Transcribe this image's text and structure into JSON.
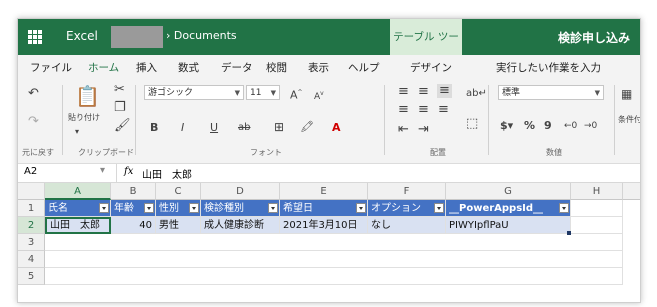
{
  "titlebar": {
    "app_name": "Excel",
    "breadcrumb": "Documents",
    "breadcrumb_sep": "›",
    "table_tools": "テーブル ツール",
    "doc_title": "検診申し込み"
  },
  "tabs": [
    "ファイル",
    "ホーム",
    "挿入",
    "数式",
    "データ",
    "校閲",
    "表示",
    "ヘルプ",
    "デザイン",
    "実行したい作業を入力"
  ],
  "active_tab": "ホーム",
  "ribbon": {
    "undo_label": "元に戻す",
    "paste_label": "貼り付け",
    "clipboard_label": "クリップボード",
    "font_name": "游ゴシック",
    "font_size": "11",
    "font_label": "フォント",
    "align_label": "配置",
    "number_format": "標準",
    "number_label": "数値",
    "bold": "B",
    "italic": "I",
    "underline": "U",
    "strike": "ab",
    "grow_font": "A",
    "shrink_font": "A",
    "currency": "$",
    "percent": "%",
    "comma": "9",
    "cond_format": "条件付"
  },
  "formula_bar": {
    "name_box": "A2",
    "fx": "fx",
    "value": "山田　太郎"
  },
  "columns": [
    "A",
    "B",
    "C",
    "D",
    "E",
    "F",
    "G",
    "H"
  ],
  "rows": [
    "1",
    "2",
    "3",
    "4",
    "5"
  ],
  "table_headers": [
    "氏名",
    "年齢",
    "性別",
    "検診種別",
    "希望日",
    "オプション",
    "__PowerAppsId__"
  ],
  "table_row": [
    "山田　太郎",
    "40",
    "男性",
    "成人健康診断",
    "2021年3月10日",
    "なし",
    "PIWYIpflPaU"
  ],
  "colors": {
    "accent": "#217346",
    "header_fill": "#4472c4",
    "row_fill": "#d9e1f2"
  }
}
